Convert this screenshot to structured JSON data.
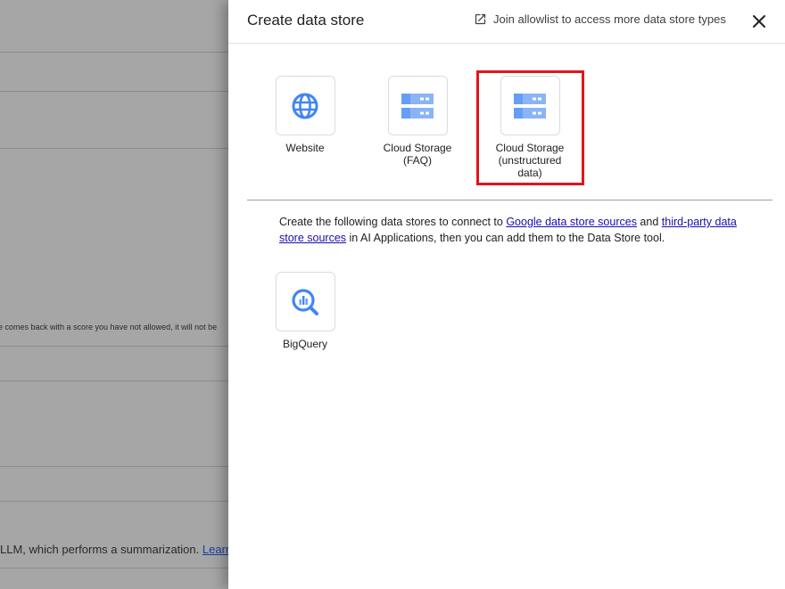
{
  "background": {
    "partial_text": "e comes back with a score you have not allowed, it will not be",
    "partial_text_2": "LLM, which performs a summarization.",
    "partial_link": "Learn"
  },
  "drawer": {
    "title": "Create data store",
    "allowlist_label": "Join allowlist to access more data store types",
    "close_icon": "close-icon",
    "tiles": [
      {
        "label": "Website",
        "icon": "globe-icon"
      },
      {
        "label": "Cloud Storage (FAQ)",
        "icon": "storage-icon"
      },
      {
        "label": "Cloud Storage (unstructured data)",
        "icon": "storage-icon"
      }
    ],
    "description": {
      "before": "Create the following data stores to connect to ",
      "link1": "Google data store sources",
      "middle": " and ",
      "link2": "third-party data store sources",
      "after": " in AI Applications, then you can add them to the Data Store tool."
    },
    "extra_tiles": [
      {
        "label": "BigQuery",
        "icon": "bigquery-icon"
      }
    ],
    "accent_color": "#4285f4",
    "highlight_color": "#e0141e"
  }
}
